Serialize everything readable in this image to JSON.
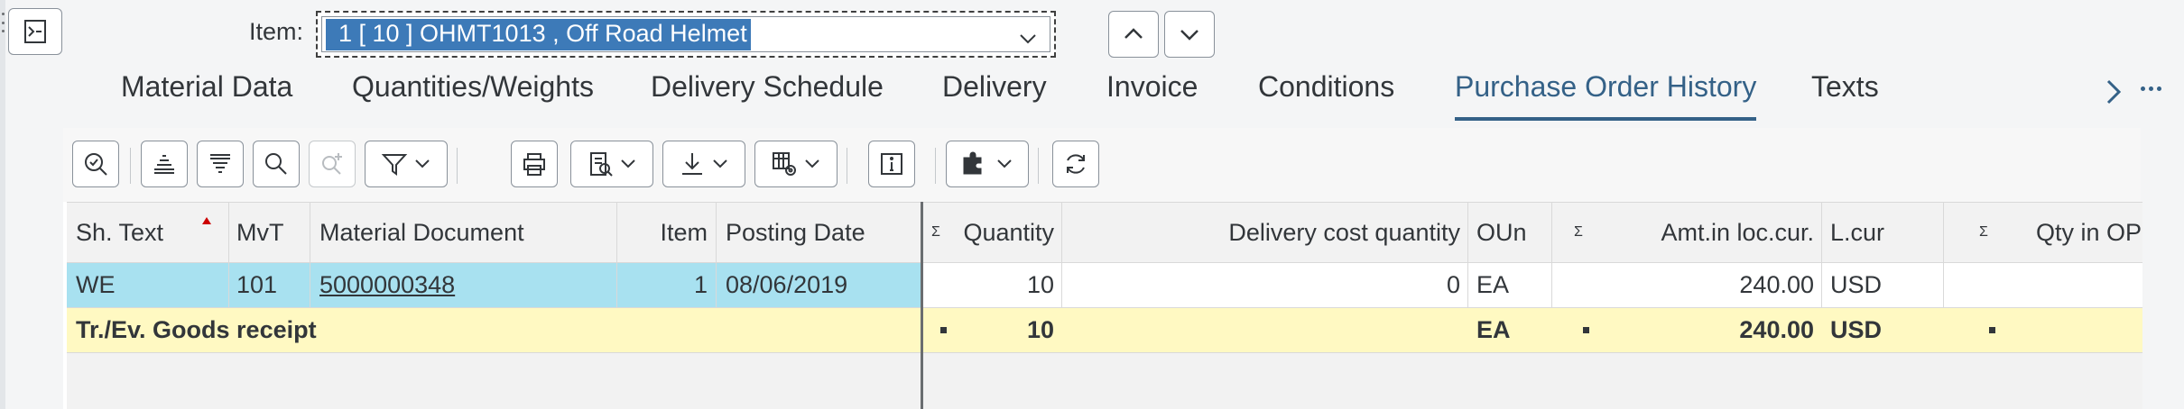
{
  "header": {
    "item_label": "Item:",
    "item_value": "1 [ 10 ] OHMT1013 , Off Road Helmet"
  },
  "tabs": [
    {
      "label": "Material Data"
    },
    {
      "label": "Quantities/Weights"
    },
    {
      "label": "Delivery Schedule"
    },
    {
      "label": "Delivery"
    },
    {
      "label": "Invoice"
    },
    {
      "label": "Conditions"
    },
    {
      "label": "Purchase Order History",
      "active": true
    },
    {
      "label": "Texts"
    }
  ],
  "toolbar": {
    "icons": [
      "details-icon",
      "sort-ascending-icon",
      "sort-descending-icon",
      "find-icon",
      "find-next-icon",
      "filter-icon",
      "print-icon",
      "view-icon",
      "export-icon",
      "layout-icon",
      "info-icon",
      "puzzle-icon",
      "refresh-icon"
    ]
  },
  "table": {
    "columns": {
      "sh_text": "Sh. Text",
      "mvt": "MvT",
      "material_document": "Material Document",
      "item": "Item",
      "posting_date": "Posting Date",
      "sum_symbol": "Σ",
      "quantity": "Quantity",
      "delivery_cost_quantity": "Delivery cost quantity",
      "oun": "OUn",
      "amt_loc_cur": "Amt.in loc.cur.",
      "l_cur": "L.cur",
      "qty_in_op": "Qty in OP"
    },
    "rows": [
      {
        "sh_text": "WE",
        "mvt": "101",
        "material_document": "5000000348",
        "item": "1",
        "posting_date": "08/06/2019",
        "quantity": "10",
        "delivery_cost_quantity": "0",
        "oun": "EA",
        "amt_loc_cur": "240.00",
        "l_cur": "USD",
        "qty_in_op": ""
      }
    ],
    "total_row": {
      "label": "Tr./Ev. Goods receipt",
      "quantity": "10",
      "oun": "EA",
      "amt_loc_cur": "240.00",
      "l_cur": "USD"
    }
  },
  "colors": {
    "accent": "#346187",
    "selected_row": "#a8e1f0",
    "total_row": "#fff9c2",
    "item_highlight": "#3d7ab8"
  }
}
